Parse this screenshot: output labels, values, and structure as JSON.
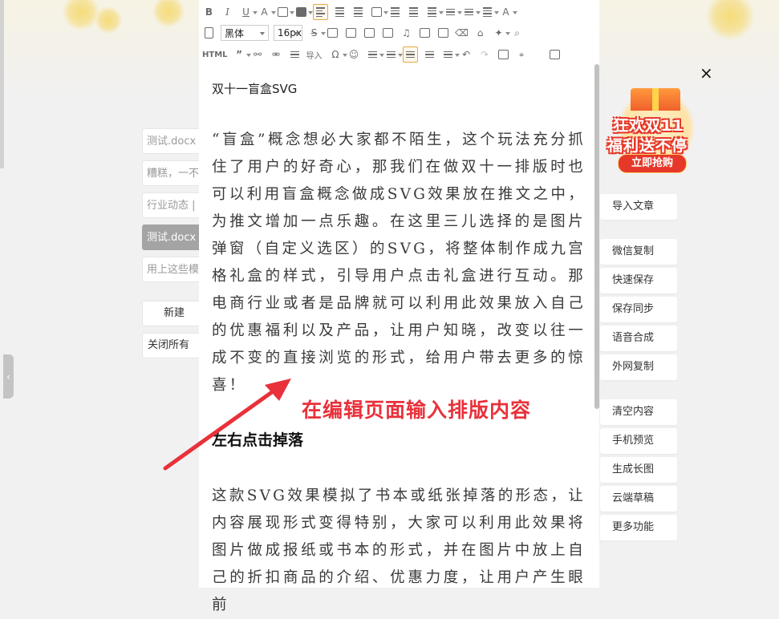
{
  "toolbar": {
    "font_family": "黑体",
    "font_size": "16px",
    "html_label": "HTML",
    "import_label": "导入"
  },
  "file_list": {
    "items": [
      "测试.docx",
      "糟糕，一不",
      "行业动态 |",
      "测试.docx",
      "用上这些模"
    ],
    "active_index": 3
  },
  "left_actions": {
    "new": "新建",
    "close_all": "关闭所有"
  },
  "editor": {
    "doc_title": "双十一盲盒SVG",
    "paragraph1": "“盲盒”概念想必大家都不陌生，这个玩法充分抓住了用户的好奇心，那我们在做双十一排版时也可以利用盲盒概念做成SVG效果放在推文之中，为推文增加一点乐趣。在这里三儿选择的是图片弹窗（自定义选区）的SVG，将整体制作成九宫格礼盒的样式，引导用户点击礼盒进行互动。那电商行业或者是品牌就可以利用此效果放入自己的优惠福利以及产品，让用户知晓，改变以往一成不变的直接浏览的形式，给用户带去更多的惊喜！",
    "section_title": "左右点击掉落",
    "paragraph2": "这款SVG效果模拟了书本或纸张掉落的形态，让内容展现形式变得特别，大家可以利用此效果将图片做成报纸或书本的形式，并在图片中放上自己的折扣商品的介绍、优惠力度，让用户产生眼前"
  },
  "annotation": {
    "text": "在编辑页面输入排版内容",
    "color": "#e8313b"
  },
  "promo": {
    "line1": "狂欢双11",
    "line2": "福利送不停",
    "button": "立即抢购"
  },
  "right_panel": {
    "close": "×",
    "import_article": "导入文章",
    "group1": [
      "微信复制",
      "快速保存",
      "保存同步",
      "语音合成",
      "外网复制"
    ],
    "group2": [
      "清空内容",
      "手机预览",
      "生成长图",
      "云端草稿",
      "更多功能"
    ]
  }
}
